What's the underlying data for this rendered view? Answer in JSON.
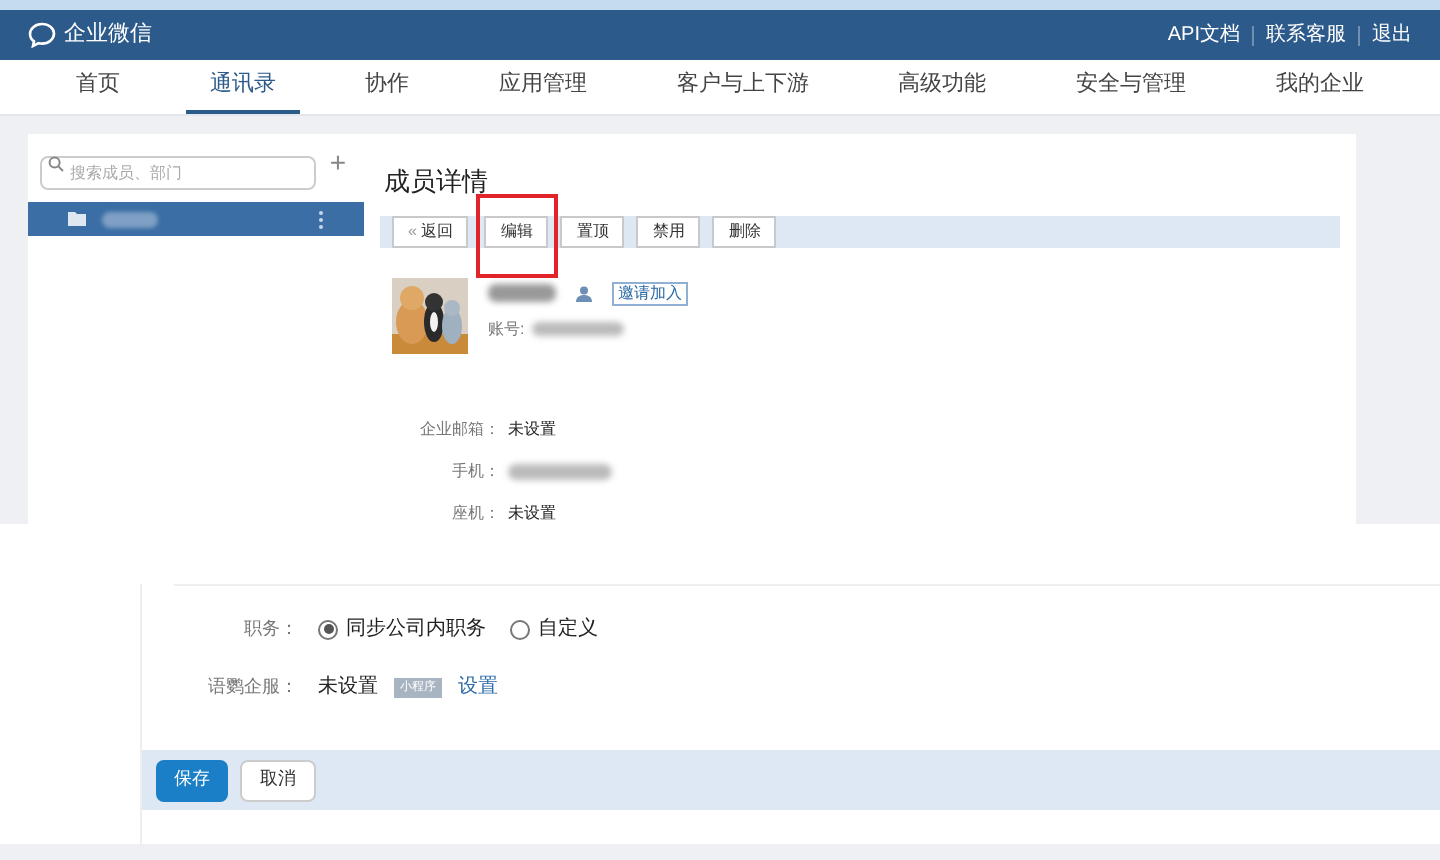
{
  "header": {
    "logo_text": "企业微信",
    "links": [
      "API文档",
      "联系客服",
      "退出"
    ]
  },
  "nav": [
    {
      "label": "首页",
      "selected": false
    },
    {
      "label": "通讯录",
      "selected": true
    },
    {
      "label": "协作",
      "selected": false
    },
    {
      "label": "应用管理",
      "selected": false
    },
    {
      "label": "客户与上下游",
      "selected": false
    },
    {
      "label": "高级功能",
      "selected": false
    },
    {
      "label": "安全与管理",
      "selected": false
    },
    {
      "label": "我的企业",
      "selected": false
    }
  ],
  "sidebar": {
    "search_placeholder": "搜索成员、部门",
    "add": "+",
    "items": [
      {
        "selected": true
      }
    ]
  },
  "detail": {
    "title": "成员详情",
    "toolbar": [
      {
        "label": "返回",
        "kind": "back",
        "icon": "«",
        "highlighted": false
      },
      {
        "label": "编辑",
        "kind": "normal",
        "highlighted": true
      },
      {
        "label": "置顶",
        "kind": "normal",
        "highlighted": false
      },
      {
        "label": "禁用",
        "kind": "normal",
        "highlighted": false
      },
      {
        "label": "删除",
        "kind": "normal",
        "highlighted": false
      }
    ],
    "invite": "邀请加入",
    "account_label": "账号:",
    "fields": [
      {
        "label": "企业邮箱：",
        "value": "未设置",
        "blurred": false
      },
      {
        "label": "手机：",
        "blurred": true
      },
      {
        "label": "座机：",
        "value": "未设置",
        "blurred": false
      }
    ]
  },
  "edit_form": {
    "position_label": "职务：",
    "options": [
      {
        "label": "同步公司内职务",
        "selected": true
      },
      {
        "label": "自定义",
        "selected": false
      }
    ],
    "service_label": "语鹦企服：",
    "service_value": "未设置",
    "badge": "小程序",
    "set_link": "设置",
    "buttons": [
      {
        "label": "保存",
        "kind": "primary"
      },
      {
        "label": "取消",
        "kind": "secondary"
      }
    ]
  }
}
